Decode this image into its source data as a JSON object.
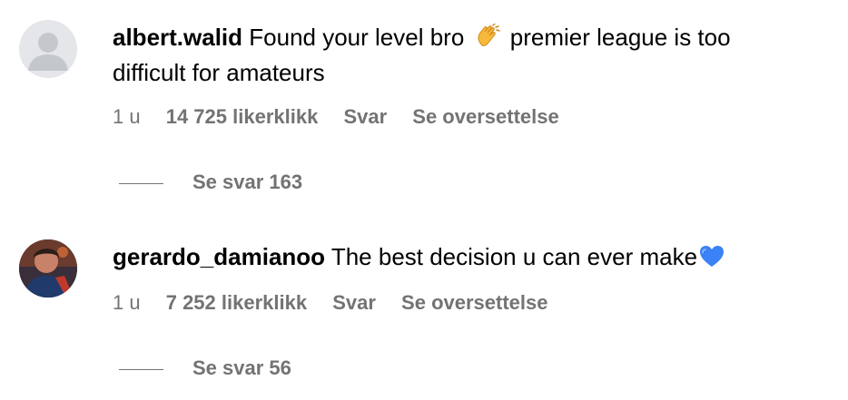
{
  "comments": [
    {
      "username": "albert.walid",
      "text_before_emoji": "Found your level bro",
      "emoji": "clapping-hands-icon",
      "text_after_emoji": "premier league is too difficult for amateurs",
      "time": "1 u",
      "likes": "14 725 likerklikk",
      "reply_label": "Svar",
      "translate_label": "Se oversettelse",
      "view_replies": "Se svar 163"
    },
    {
      "username": "gerardo_damianoo",
      "text_before_emoji": "The best decision u can ever make",
      "emoji": "blue-heart-icon",
      "text_after_emoji": "",
      "time": "1 u",
      "likes": "7 252 likerklikk",
      "reply_label": "Svar",
      "translate_label": "Se oversettelse",
      "view_replies": "Se svar 56"
    }
  ],
  "colors": {
    "text": "#000000",
    "meta": "#737373",
    "avatar_placeholder": "#e4e6e9",
    "avatar_placeholder_glyph": "#c4c7cc",
    "heart": "#3b82f6"
  }
}
